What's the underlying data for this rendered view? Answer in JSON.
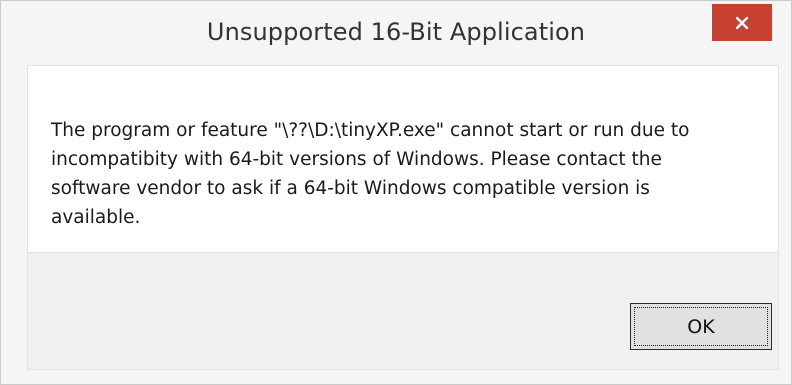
{
  "window": {
    "title": "Unsupported 16-Bit Application",
    "close_icon": "close-icon"
  },
  "message": {
    "text": "The program or feature \"\\??\\D:\\tinyXP.exe\" cannot start or run due to incompatibity with 64-bit versions of Windows. Please contact the software vendor to ask if a 64-bit Windows compatible version is available."
  },
  "buttons": {
    "ok_label": "OK"
  },
  "colors": {
    "close_button_bg": "#c84031",
    "titlebar_bg": "#f5f5f5",
    "button_area_bg": "#f0f0f0"
  }
}
